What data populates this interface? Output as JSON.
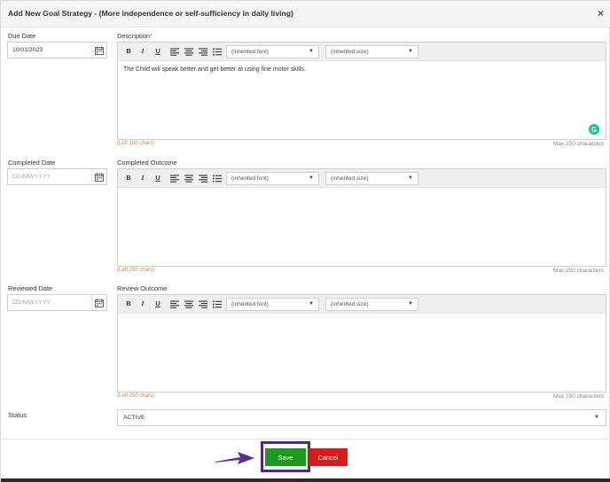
{
  "dialog": {
    "title": "Add New Goal Strategy - (More independence or self-sufficiency in daily living)",
    "close_glyph": "×"
  },
  "fields": {
    "due_date": {
      "label": "Due Date",
      "value": "10/01/2023"
    },
    "completed_date": {
      "label": "Completed Date",
      "placeholder": "DD/MM/YYYY"
    },
    "reviewed_date": {
      "label": "Reviewed Date",
      "placeholder": "DD/MM/YYYY"
    },
    "status": {
      "label": "Status",
      "value": "ACTIVE"
    }
  },
  "editors": {
    "description": {
      "label": "Description",
      "required_mark": "*",
      "content": "The Child will speak better and get better at using fine motor skills.",
      "left_chars": "(Left 180 chars)",
      "max_chars": "Max 250 characters"
    },
    "completed_outcome": {
      "label": "Completed Outcome",
      "content": "",
      "left_chars": "(Left 250 chars)",
      "max_chars": "Max 250 characters"
    },
    "review_outcome": {
      "label": "Review Outcome",
      "content": "",
      "left_chars": "(Left 250 chars)",
      "max_chars": "Max 250 characters"
    }
  },
  "toolbar": {
    "bold": "B",
    "italic": "I",
    "underline": "U",
    "font_select": "(inherited font)",
    "size_select": "(inherited size)",
    "dropdown_glyph": "▼",
    "icons": [
      "align-left-icon",
      "align-center-icon",
      "align-right-icon",
      "bullet-list-icon"
    ]
  },
  "buttons": {
    "save": "Save",
    "cancel": "Cancel"
  },
  "colors": {
    "save": "#1c9a1c",
    "cancel": "#dc1a1a",
    "highlight_frame": "#4b2a86",
    "required": "#d9534f",
    "char_counter": "#e67e22"
  }
}
